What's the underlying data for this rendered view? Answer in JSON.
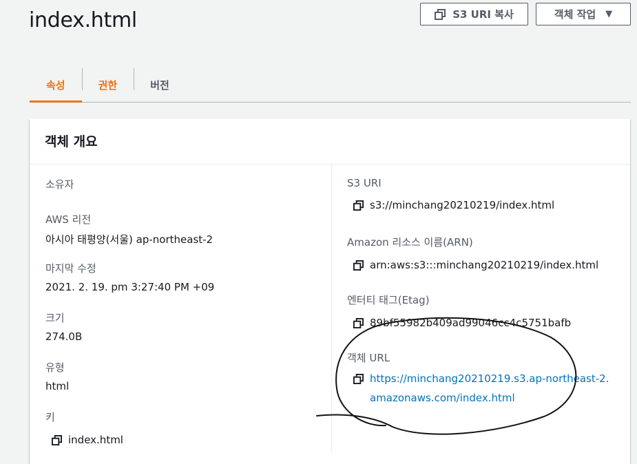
{
  "page": {
    "title": "index.html"
  },
  "header_buttons": {
    "copy_s3_uri": "S3 URI 복사",
    "object_actions": "객체 작업"
  },
  "tabs": [
    {
      "label": "속성",
      "active": true
    },
    {
      "label": "권한",
      "active": false
    },
    {
      "label": "버전",
      "active": false
    }
  ],
  "overview": {
    "title": "객체 개요",
    "owner": {
      "label": "소유자",
      "value": ""
    },
    "region": {
      "label": "AWS 리전",
      "value": "아시아 태평양(서울) ap-northeast-2"
    },
    "last_modified": {
      "label": "마지막 수정",
      "value": "2021. 2. 19. pm 3:27:40 PM +09"
    },
    "size": {
      "label": "크기",
      "value": "274.0B"
    },
    "type": {
      "label": "유형",
      "value": "html"
    },
    "key": {
      "label": "키",
      "value": "index.html"
    },
    "s3_uri": {
      "label": "S3 URI",
      "value": "s3://minchang20210219/index.html"
    },
    "arn": {
      "label": "Amazon 리소스 이름(ARN)",
      "value": "arn:aws:s3:::minchang20210219/index.html"
    },
    "etag": {
      "label": "엔터티 태그(Etag)",
      "value": "89bf55982b409ad99046cc4c5751bafb"
    },
    "object_url": {
      "label": "객체 URL",
      "value": "https://minchang20210219.s3.ap-northeast-2.amazonaws.com/index.html"
    }
  },
  "colors": {
    "accent": "#ec7211",
    "link": "#0073bb",
    "text": "#16191f",
    "muted": "#545b64"
  },
  "icons": {
    "copy": "copy-icon",
    "caret": "caret-down-icon"
  }
}
